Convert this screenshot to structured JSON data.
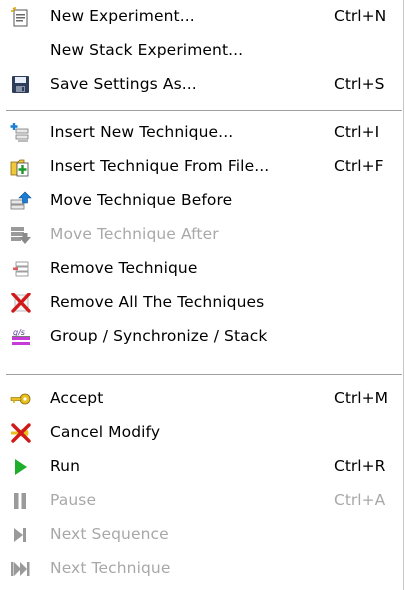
{
  "menu": {
    "items": [
      {
        "label": "New Experiment...",
        "shortcut": "Ctrl+N",
        "icon": "new-experiment-icon",
        "enabled": true
      },
      {
        "label": "New Stack Experiment...",
        "shortcut": "",
        "icon": "",
        "enabled": true
      },
      {
        "label": "Save Settings As...",
        "shortcut": "Ctrl+S",
        "icon": "save-disk-icon",
        "enabled": true
      },
      {
        "label": "Insert New Technique...",
        "shortcut": "Ctrl+I",
        "icon": "insert-technique-icon",
        "enabled": true
      },
      {
        "label": "Insert Technique From File...",
        "shortcut": "Ctrl+F",
        "icon": "insert-from-file-icon",
        "enabled": true
      },
      {
        "label": "Move Technique Before",
        "shortcut": "",
        "icon": "move-before-icon",
        "enabled": true
      },
      {
        "label": "Move Technique After",
        "shortcut": "",
        "icon": "move-after-icon",
        "enabled": false
      },
      {
        "label": "Remove Technique",
        "shortcut": "",
        "icon": "remove-technique-icon",
        "enabled": true
      },
      {
        "label": "Remove All The Techniques",
        "shortcut": "",
        "icon": "remove-all-icon",
        "enabled": true
      },
      {
        "label": "Group / Synchronize / Stack",
        "shortcut": "",
        "icon": "group-synchronize-icon",
        "enabled": true
      },
      {
        "label": "Accept",
        "shortcut": "Ctrl+M",
        "icon": "accept-key-icon",
        "enabled": true
      },
      {
        "label": "Cancel Modify",
        "shortcut": "",
        "icon": "cancel-modify-icon",
        "enabled": true
      },
      {
        "label": "Run",
        "shortcut": "Ctrl+R",
        "icon": "run-play-icon",
        "enabled": true
      },
      {
        "label": "Pause",
        "shortcut": "Ctrl+A",
        "icon": "pause-icon",
        "enabled": false
      },
      {
        "label": "Next Sequence",
        "shortcut": "",
        "icon": "next-sequence-icon",
        "enabled": false
      },
      {
        "label": "Next Technique",
        "shortcut": "",
        "icon": "next-technique-icon",
        "enabled": false
      }
    ],
    "group_icon_text": "g/s"
  },
  "colors": {
    "disabled_text": "#a8a8a8",
    "run_green": "#1fae2b",
    "remove_red": "#d21919",
    "accept_yellow": "#e8c020"
  }
}
